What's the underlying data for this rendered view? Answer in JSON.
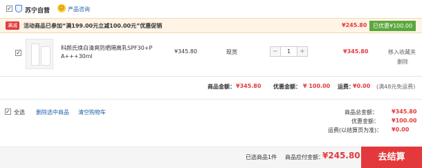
{
  "shop": {
    "name": "苏宁自营",
    "consult": "产品咨询"
  },
  "promo": {
    "tag": "满减",
    "text": "活动商品已参加“满199.00元立减100.00元”优惠促销",
    "total": "¥245.80",
    "discount_badge": "已优惠¥100.00"
  },
  "item": {
    "title_line1": "科颜氏焕白清爽防晒隔离乳SPF30+P",
    "title_line2": "A+++30ml",
    "unit_price": "¥345.80",
    "stock": "现货",
    "quantity": "1",
    "minus": "−",
    "plus": "+",
    "subtotal": "¥345.80",
    "move_to_favorites": "移入收藏夹",
    "delete": "删除"
  },
  "shop_summary": {
    "goods_label": "商品金额：",
    "goods_value": "¥345.80",
    "discount_label": "优惠金额：",
    "discount_value": "¥ 100.00",
    "shipping_label": "运费：",
    "shipping_value": "¥0.00",
    "shipping_note": "(满48元免运费)"
  },
  "footer_actions": {
    "select_all": "全选",
    "delete_selected": "删除选中商品",
    "clear_cart": "清空购物车"
  },
  "cart_totals": {
    "goods_label": "商品总金额：",
    "goods_value": "¥345.80",
    "discount_label": "优惠金额：",
    "discount_value": "¥100.00",
    "shipping_label": "运费(以结算页为准)：",
    "shipping_value": "¥0.00"
  },
  "bottom": {
    "selected_count": "已选商品1件",
    "payable_label": "商品应付金额：",
    "payable_value": "¥245.80",
    "checkout": "去结算"
  },
  "colors": {
    "accent_red": "#e4393c",
    "discount_green": "#5aa83d",
    "promo_bg": "#fff4e6"
  }
}
